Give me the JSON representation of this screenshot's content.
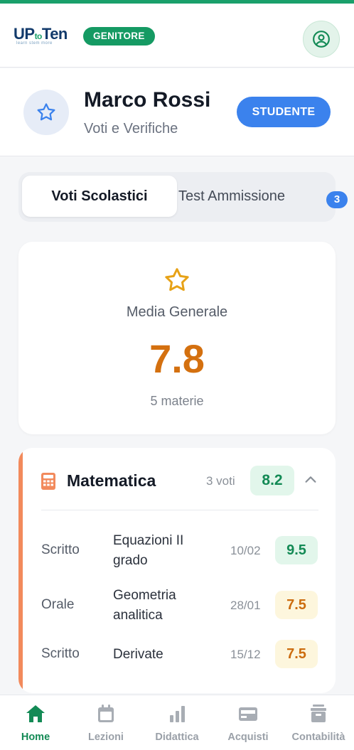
{
  "header": {
    "logo_text_up": "UP",
    "logo_text_to": "to",
    "logo_text_ten": "Ten",
    "logo_tagline": "learn stem more",
    "role_badge": "GENITORE",
    "accent_color": "#1aa06b"
  },
  "student": {
    "name": "Marco Rossi",
    "subtitle": "Voti e Verifiche",
    "badge": "STUDENTE"
  },
  "tabs": {
    "active": "Voti Scolastici",
    "inactive": "Test Ammissione",
    "inactive_count": "3"
  },
  "average": {
    "label": "Media Generale",
    "value": "7.8",
    "subjects_count": "5 materie"
  },
  "subject": {
    "name": "Matematica",
    "count": "3 voti",
    "average": "8.2",
    "grades": [
      {
        "type": "Scritto",
        "description": "Equazioni II grado",
        "date": "10/02",
        "value": "9.5",
        "level": "high"
      },
      {
        "type": "Orale",
        "description": "Geometria analitica",
        "date": "28/01",
        "value": "7.5",
        "level": "mid"
      },
      {
        "type": "Scritto",
        "description": "Derivate",
        "date": "15/12",
        "value": "7.5",
        "level": "mid"
      }
    ]
  },
  "nav": {
    "items": [
      {
        "label": "Home",
        "icon": "home-icon",
        "active": true
      },
      {
        "label": "Lezioni",
        "icon": "calendar-icon",
        "active": false
      },
      {
        "label": "Didattica",
        "icon": "bar-chart-icon",
        "active": false
      },
      {
        "label": "Acquisti",
        "icon": "credit-card-icon",
        "active": false
      },
      {
        "label": "Contabilità",
        "icon": "archive-icon",
        "active": false
      }
    ]
  },
  "colors": {
    "green": "#138a55",
    "blue": "#3b82ed",
    "orange": "#d4700f",
    "subject_accent": "#f28a5c"
  }
}
